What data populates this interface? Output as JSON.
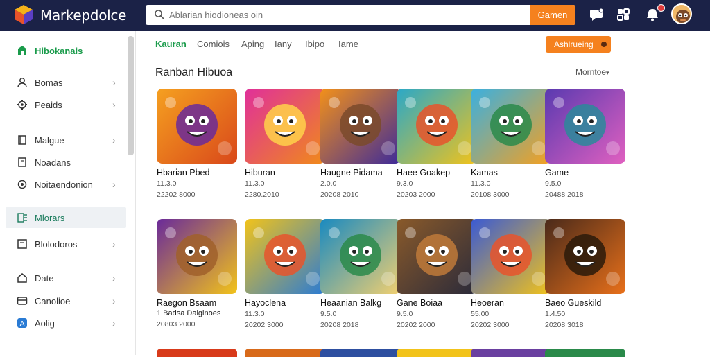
{
  "header": {
    "brand": "Markepdolce",
    "search_placeholder": "Ablarian hiodioneas oin",
    "search_button": "Gamen"
  },
  "sidebar": {
    "items": [
      {
        "label": "Hibokanais",
        "icon": "home-icon",
        "chevron": false,
        "style": "active-green"
      },
      {
        "label": "Bomas",
        "icon": "user-icon",
        "chevron": true
      },
      {
        "label": "Peaids",
        "icon": "gear-icon",
        "chevron": true
      },
      {
        "label": "Malgue",
        "icon": "book-icon",
        "chevron": true
      },
      {
        "label": "Noadans",
        "icon": "bookmark-icon",
        "chevron": false
      },
      {
        "label": "Noitaendonion",
        "icon": "settings-icon",
        "chevron": true
      },
      {
        "label": "Mlorars",
        "icon": "list-icon",
        "chevron": false,
        "style": "selected"
      },
      {
        "label": "Blolodoros",
        "icon": "square-icon",
        "chevron": true
      },
      {
        "label": "Date",
        "icon": "home-outline-icon",
        "chevron": true
      },
      {
        "label": "Canolioe",
        "icon": "card-icon",
        "chevron": true
      },
      {
        "label": "Aolig",
        "icon": "app-icon",
        "chevron": true
      }
    ]
  },
  "tabs": {
    "items": [
      "Kauran",
      "Comiois",
      "Aping",
      "Iany",
      "Ibipo",
      "Iame"
    ],
    "active": 0,
    "cta": "Ashlrueing"
  },
  "section": {
    "title": "Ranban Hibuoa",
    "more": "Morntoe"
  },
  "cards": [
    {
      "title": "Hbarian Pbed",
      "sub": "",
      "meta": "11.3.0",
      "meta2": "22202 8000"
    },
    {
      "title": "Hiburan",
      "sub": "",
      "meta": "11.3.0",
      "meta2": "2280.2010"
    },
    {
      "title": "Haugne Pidama",
      "sub": "",
      "meta": "2.0.0",
      "meta2": "20208 2010"
    },
    {
      "title": "Haee Goakep",
      "sub": "",
      "meta": "9.3.0",
      "meta2": "20203 2000"
    },
    {
      "title": "Kamas",
      "sub": "",
      "meta": "11.3.0",
      "meta2": "20108 3000"
    },
    {
      "title": "Game",
      "sub": "",
      "meta": "9.5.0",
      "meta2": "20488 2018"
    },
    {
      "title": "Raegon Bsaam",
      "sub": "1 Badsa Daiginoes",
      "meta": "",
      "meta2": "20803 2000"
    },
    {
      "title": "Hayoclena",
      "sub": "",
      "meta": "11.3.0",
      "meta2": "20202 3000"
    },
    {
      "title": "Heaanian Balkg",
      "sub": "",
      "meta": "9.5.0",
      "meta2": "20208 2018"
    },
    {
      "title": "Gane Boiaa",
      "sub": "",
      "meta": "9.5.0",
      "meta2": "20202 2000"
    },
    {
      "title": "Heoeran",
      "sub": "",
      "meta": "55.00",
      "meta2": "20202 3000"
    },
    {
      "title": "Baeo Gueskild",
      "sub": "",
      "meta": "1.4.50",
      "meta2": "20208 3018"
    }
  ],
  "colors": {
    "header_bg": "#1b2247",
    "accent_orange": "#f5811e",
    "accent_green": "#1a9b4b"
  }
}
